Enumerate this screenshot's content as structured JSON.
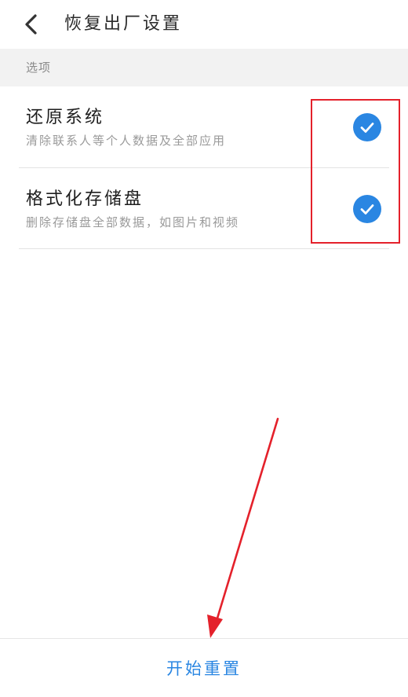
{
  "header": {
    "title": "恢复出厂设置",
    "back_icon": "chevron-left-icon"
  },
  "section": {
    "label": "选项"
  },
  "options": [
    {
      "title": "还原系统",
      "subtitle": "清除联系人等个人数据及全部应用",
      "checked": true
    },
    {
      "title": "格式化存储盘",
      "subtitle": "删除存储盘全部数据，如图片和视频",
      "checked": true
    }
  ],
  "footer": {
    "start_label": "开始重置"
  },
  "colors": {
    "accent": "#2a86e2",
    "annotation": "#e4212b",
    "section_bg": "#f2f2f2"
  }
}
